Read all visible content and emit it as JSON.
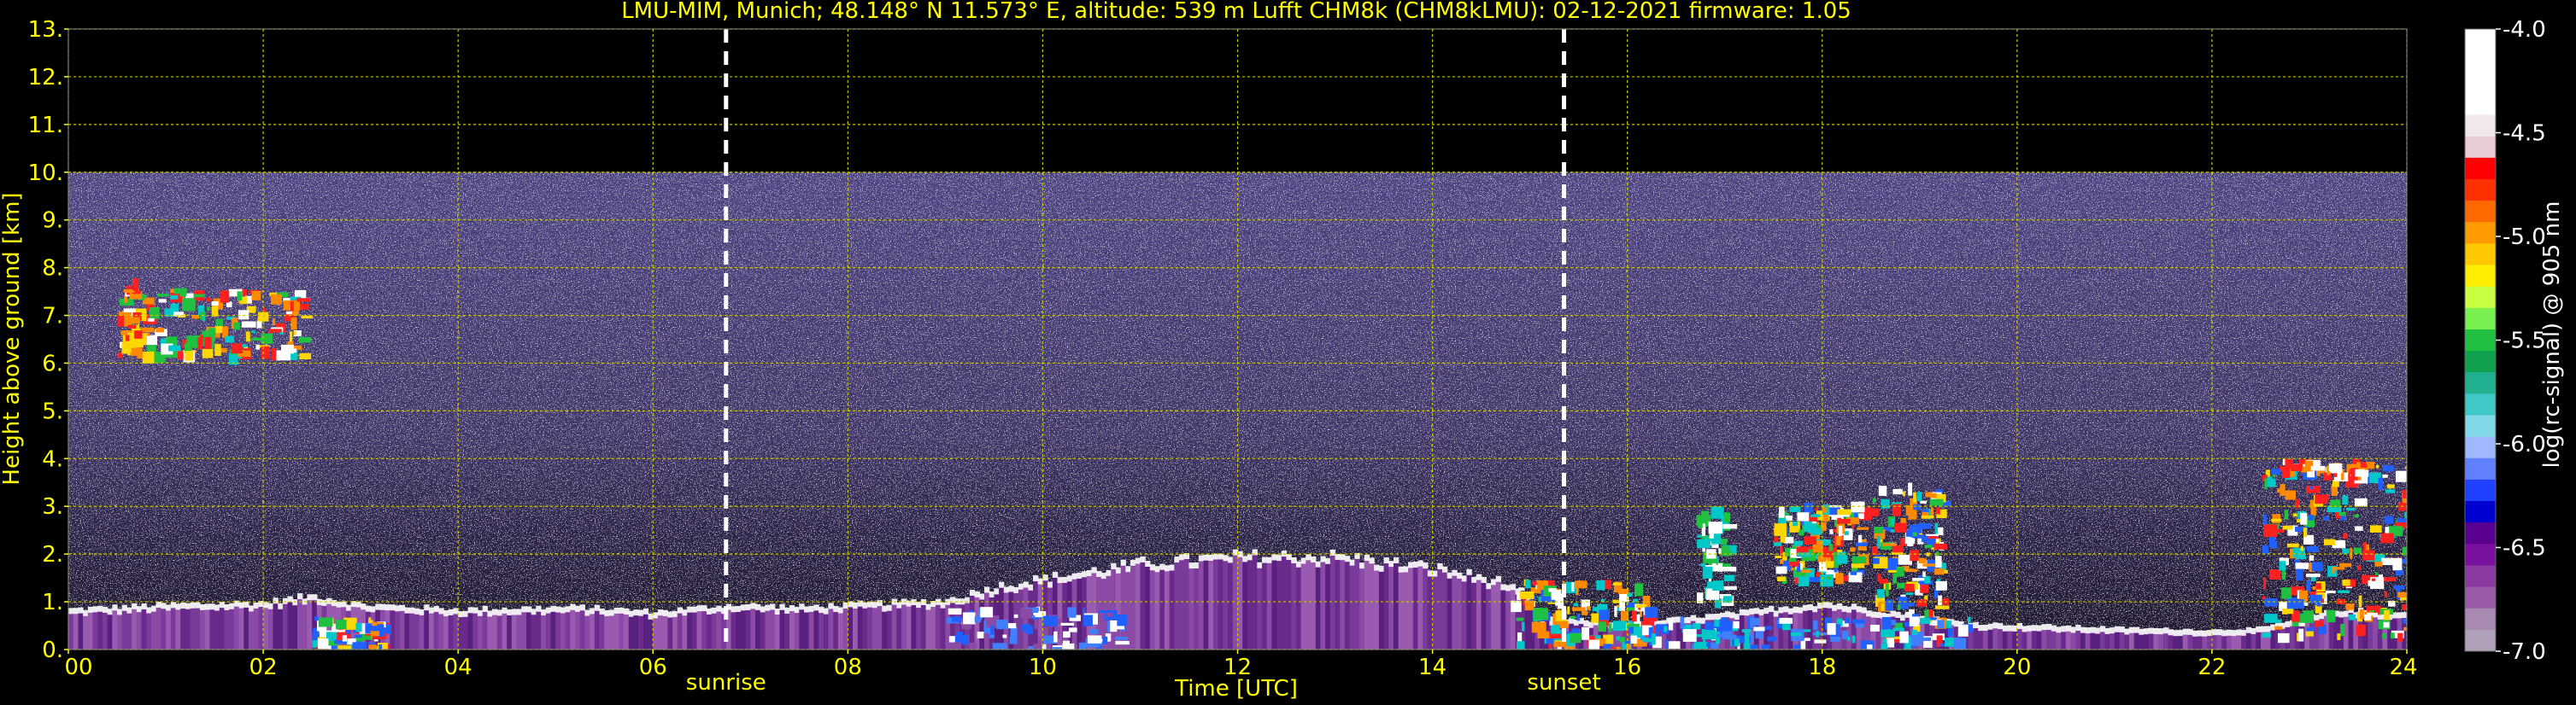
{
  "chart_data": {
    "type": "heatmap",
    "title": "LMU-MIM, Munich; 48.148° N 11.573° E, altitude: 539 m    Lufft CHM8k (CHM8kLMU): 02-12-2021    firmware: 1.05",
    "xlabel": "Time [UTC]",
    "ylabel": "Height above ground [km]",
    "xlim": [
      0,
      24
    ],
    "ylim": [
      0,
      13
    ],
    "x_ticks": [
      "00",
      "02",
      "04",
      "06",
      "08",
      "10",
      "12",
      "14",
      "16",
      "18",
      "20",
      "22",
      "24"
    ],
    "y_ticks": [
      "0.",
      "1.",
      "2.",
      "3.",
      "4.",
      "5.",
      "6.",
      "7.",
      "8.",
      "9.",
      "10.",
      "11.",
      "12.",
      "13."
    ],
    "grid": true,
    "data_ceiling_km": 10,
    "sunrise_h": 6.75,
    "sunset_h": 15.35,
    "sunrise_label": "sunrise",
    "sunset_label": "sunset",
    "colorbar": {
      "label": "log(rc-signal) @ 905 nm",
      "range": [
        -7.0,
        -4.0
      ],
      "ticks": [
        "-4.0",
        "-4.5",
        "-5.0",
        "-5.5",
        "-6.0",
        "-6.5",
        "-7.0"
      ]
    },
    "features": [
      {
        "name": "cirrus",
        "x": [
          0.5,
          2.4
        ],
        "y": [
          6.2,
          8.3
        ]
      },
      {
        "name": "boundary-layer-top",
        "x": [
          0,
          24
        ],
        "y": [
          0.6,
          2.0
        ]
      },
      {
        "name": "low-cloud",
        "x": [
          16.7,
          19.2
        ],
        "y": [
          0.3,
          3.5
        ]
      },
      {
        "name": "low-cloud",
        "x": [
          22.5,
          24
        ],
        "y": [
          0.3,
          4.0
        ]
      }
    ]
  },
  "colors": {
    "background": "#000000",
    "text": "#ffff00",
    "grid": "#c8c800",
    "marker": "#ffffff",
    "noise": "#4a3e72"
  }
}
